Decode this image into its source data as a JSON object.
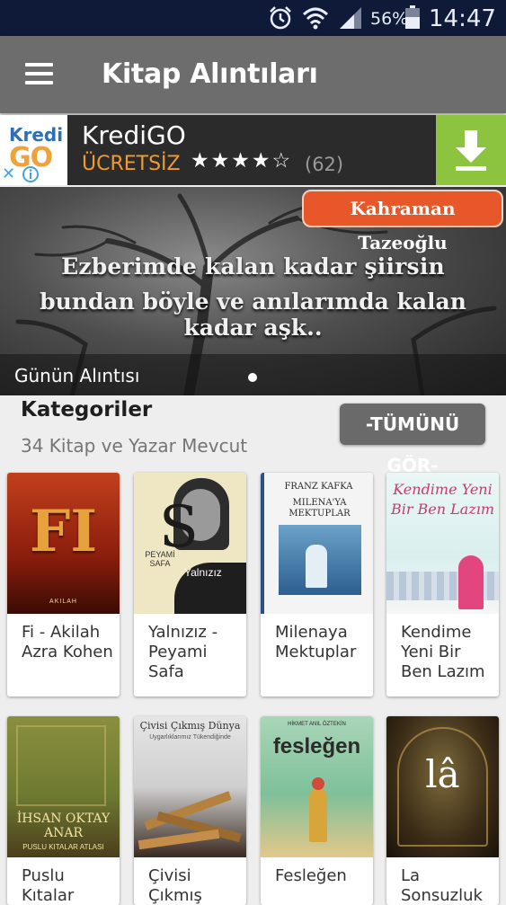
{
  "status_bar": {
    "battery_percent": "56%",
    "time": "14:47",
    "icons": [
      "alarm-icon",
      "wifi-icon",
      "signal-icon",
      "battery-icon"
    ]
  },
  "app_bar": {
    "title": "Kitap Alıntıları",
    "menu_icon": "hamburger-menu-icon"
  },
  "ad": {
    "logo_line1": "Kredi",
    "logo_line2": "GO",
    "name": "KrediGO",
    "price": "ÜCRETSİZ",
    "stars": "★★★★☆",
    "rating": 4,
    "rating_count": "(62)",
    "download_icon": "download-icon",
    "colors": {
      "price": "#f29a2e",
      "download_bg": "#8cc43f"
    }
  },
  "hero": {
    "badge": "Kahraman Tazeoğlu",
    "quote_line1": "Ezberimde kalan kadar şiirsin",
    "quote_line2": "bundan böyle ve anılarımda kalan kadar aşk..",
    "caption": "Günün Alıntısı"
  },
  "categories": {
    "title": "Kategoriler",
    "subtitle": "34 Kitap ve Yazar Mevcut",
    "see_all": "-TÜMÜNÜ GÖR-"
  },
  "books": [
    {
      "label": "Fi - Akilah Azra Kohen",
      "cover_title": "FI",
      "cover_author": "AKILAH"
    },
    {
      "label": "Yalnızız - Peyami Safa",
      "cover_title": "Yalnızız",
      "cover_author": "PEYAMİ SAFA",
      "cover_letter": "S"
    },
    {
      "label": "Milenaya Mektuplar",
      "cover_title": "MILENA'YA MEKTUPLAR",
      "cover_author": "FRANZ KAFKA"
    },
    {
      "label": "Kendime Yeni Bir Ben Lazım",
      "cover_title": "Kendime Yeni Bir Ben Lazım"
    },
    {
      "label": "Puslu Kıtalar",
      "cover_title": "İHSAN OKTAY ANAR",
      "cover_author": "PUSLU KITALAR ATLASI"
    },
    {
      "label": "Çivisi Çıkmış",
      "cover_title": "Çivisi Çıkmış Dünya",
      "cover_author": "Uygarlıklarımız Tükendiğinde"
    },
    {
      "label": "Fesleğen",
      "cover_title": "fesleğen",
      "cover_author": "HİKMET ANIL ÖZTEKİN"
    },
    {
      "label": "La Sonsuzluk",
      "cover_title": "lâ"
    }
  ]
}
